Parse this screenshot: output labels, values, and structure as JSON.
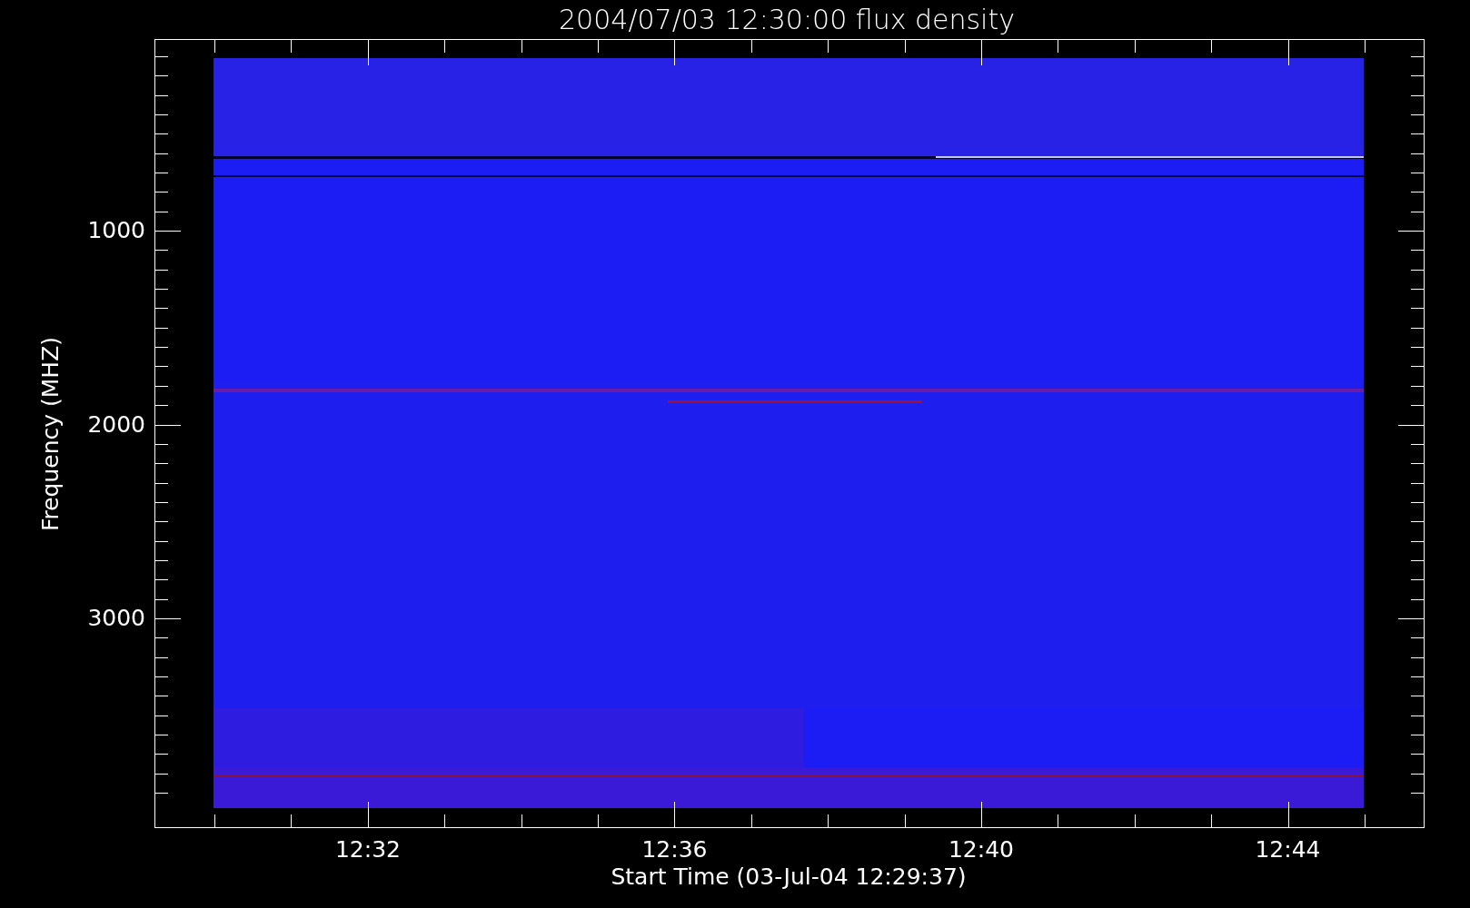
{
  "title": "2004/07/03 12:30:00 flux density",
  "y_axis": {
    "label": "Frequency (MHZ)",
    "ticks": [
      "1000",
      "2000",
      "3000"
    ]
  },
  "x_axis": {
    "label": "Start Time (03-Jul-04 12:29:37)",
    "ticks": [
      "12:32",
      "12:36",
      "12:40",
      "12:44"
    ]
  }
}
